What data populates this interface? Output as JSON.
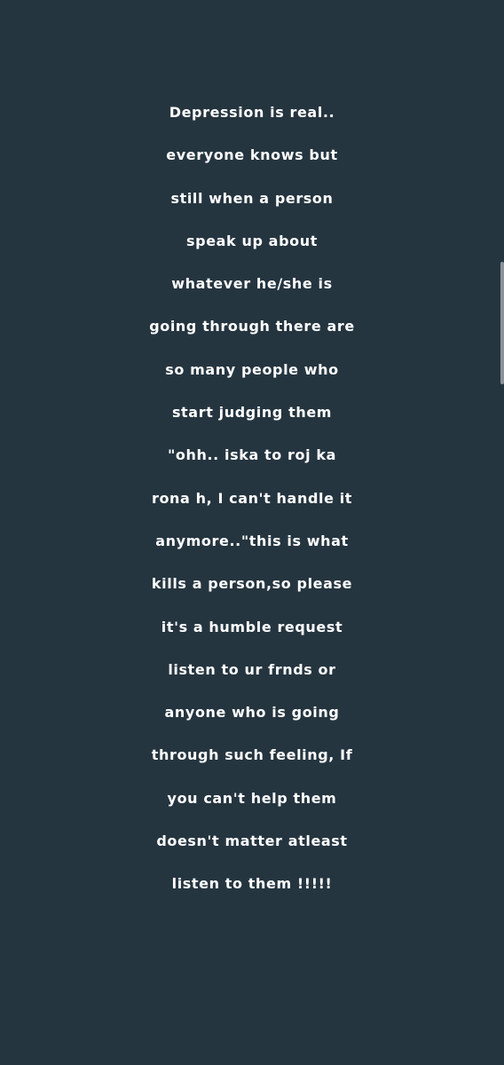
{
  "post": {
    "background_color": "#253540",
    "text_color": "#ffffff",
    "lines": [
      "Depression is real..",
      "everyone knows but",
      "still when a person",
      "speak up about",
      "whatever he/she is",
      "going through there are",
      "so many people who",
      "start judging them",
      "\"ohh.. iska to roj ka",
      "rona h, I can't handle it",
      "anymore..\"this is what",
      "kills a person,so please",
      "it's a humble request",
      "listen to ur frnds or",
      "anyone who is going",
      "through such feeling, If",
      "you can't help them",
      "doesn't matter atleast",
      "listen to them !!!!!"
    ]
  }
}
